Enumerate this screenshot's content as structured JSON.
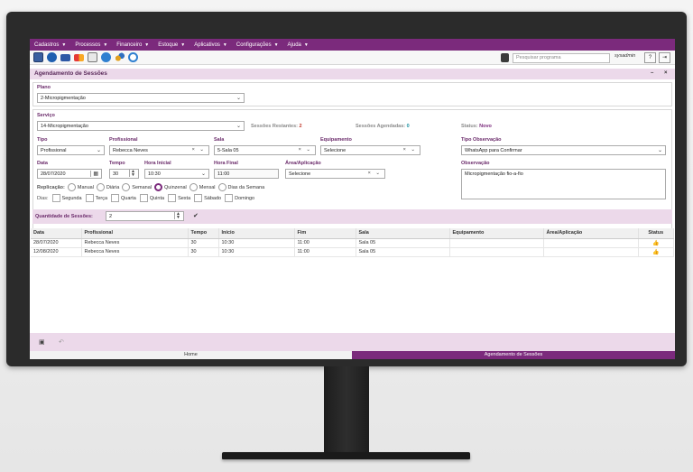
{
  "menu": [
    {
      "label": "Cadastros"
    },
    {
      "label": "Processos"
    },
    {
      "label": "Financeiro"
    },
    {
      "label": "Estoque"
    },
    {
      "label": "Aplicativos"
    },
    {
      "label": "Configurações"
    },
    {
      "label": "Ajuda"
    }
  ],
  "toolbar": {
    "search_placeholder": "Pesquisar programa",
    "user": "sysadmin",
    "help_label": "?",
    "logout_label": "⇥",
    "icons": [
      "save-icon",
      "globe-icon",
      "visa-card-icon",
      "mastercard-icon",
      "calendar-icon",
      "chat-icon",
      "users-icon",
      "refresh-icon"
    ]
  },
  "window": {
    "title": "Agendamento de Sessões",
    "minimize": "–",
    "close": "×"
  },
  "plano": {
    "label": "Plano",
    "value": "2-Micropigmentação"
  },
  "servico": {
    "label": "Serviço",
    "value": "14-Micropigmentação"
  },
  "sessoes_restantes": {
    "label": "Sessões Restantes:",
    "value": "2"
  },
  "sessoes_agendadas": {
    "label": "Sessões Agendadas:",
    "value": "0"
  },
  "status": {
    "label": "Status:",
    "value": "Novo"
  },
  "tipo": {
    "label": "Tipo",
    "value": "Profissional"
  },
  "profissional": {
    "label": "Profissional",
    "value": "Rebecca Neves"
  },
  "sala": {
    "label": "Sala",
    "value": "5-Sala 05"
  },
  "equipamento": {
    "label": "Equipamento",
    "value": "Selecione"
  },
  "tipo_observacao": {
    "label": "Tipo Observação",
    "value": "WhatsApp para Confirmar"
  },
  "data": {
    "label": "Data",
    "value": "28/07/2020"
  },
  "tempo": {
    "label": "Tempo",
    "value": "30"
  },
  "hora_inicial": {
    "label": "Hora Inicial",
    "value": "10:30"
  },
  "hora_final": {
    "label": "Hora Final",
    "value": "11:00"
  },
  "area": {
    "label": "Área/Aplicação",
    "value": "Selecione"
  },
  "observacao": {
    "label": "Observação",
    "value": "Micropigmentação fio-a-fio"
  },
  "replicacao": {
    "label": "Replicação:",
    "options": [
      "Manual",
      "Diária",
      "Semanal",
      "Quinzenal",
      "Mensal",
      "Dias da Semana"
    ],
    "selected": "Quinzenal"
  },
  "dias": {
    "label": "Dias:",
    "options": [
      "Segunda",
      "Terça",
      "Quarta",
      "Quinta",
      "Sexta",
      "Sábado",
      "Domingo"
    ]
  },
  "quantidade": {
    "label": "Quantidade de Sessões:",
    "value": "2",
    "confirm": "✔"
  },
  "table": {
    "headers": [
      "Data",
      "Profissional",
      "Tempo",
      "Início",
      "Fim",
      "Sala",
      "Equipamento",
      "Área/Aplicação",
      "Status"
    ],
    "rows": [
      [
        "28/07/2020",
        "Rebecca Neves",
        "30",
        "10:30",
        "11:00",
        "Sala 05",
        "",
        "",
        ""
      ],
      [
        "12/08/2020",
        "Rebecca Neves",
        "30",
        "10:30",
        "11:00",
        "Sala 05",
        "",
        "",
        ""
      ]
    ]
  },
  "tabs": [
    {
      "label": "Home"
    },
    {
      "label": "Agendamento de Sessões"
    }
  ],
  "colors": {
    "accent": "#7b2a7c",
    "light_accent": "#ecd9ea",
    "status_ok": "#2e8b2e"
  }
}
